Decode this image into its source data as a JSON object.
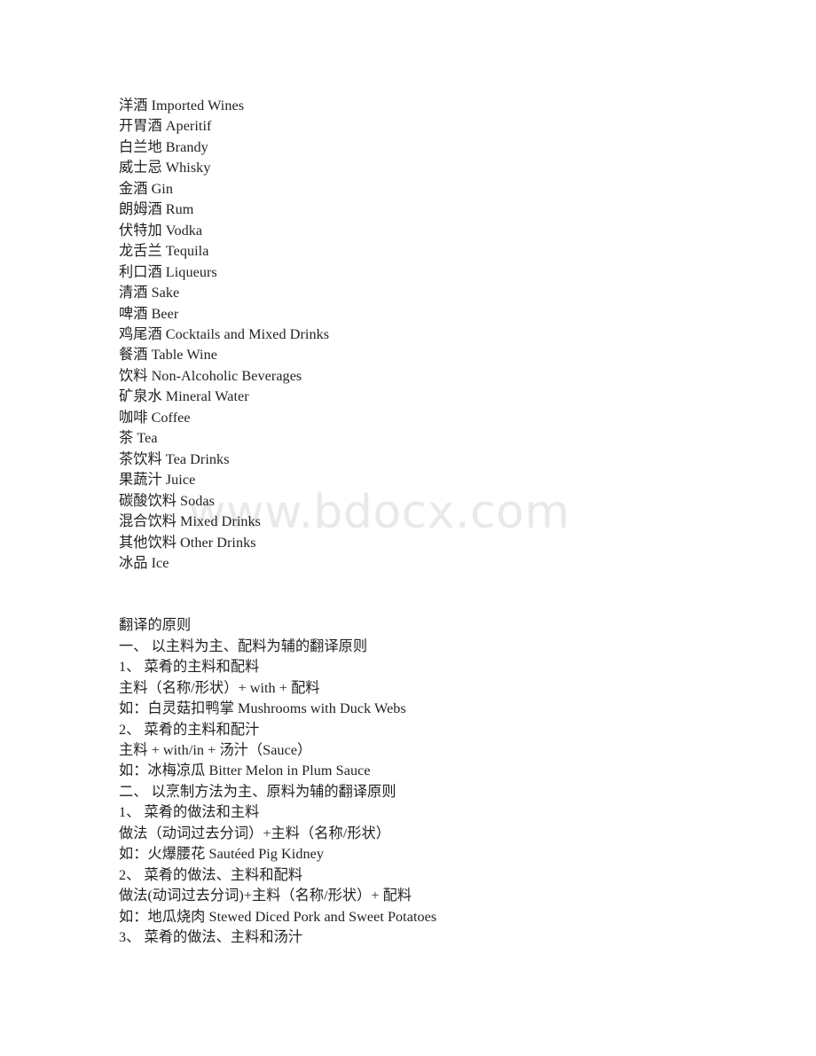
{
  "document": {
    "page_background": "#ffffff",
    "text_color": "#231f20",
    "watermark": {
      "text": "www.bdocx.com",
      "color": "#e9e9e9"
    },
    "sections": [
      {
        "id": "beverage-glossary",
        "name": "beverage-glossary",
        "lines": [
          "洋酒 Imported Wines",
          "开胃酒 Aperitif",
          "白兰地 Brandy",
          "威士忌 Whisky",
          "金酒 Gin",
          "朗姆酒 Rum",
          "伏特加 Vodka",
          "龙舌兰 Tequila",
          "利口酒 Liqueurs",
          "清酒 Sake",
          "啤酒 Beer",
          "鸡尾酒 Cocktails and Mixed Drinks",
          "餐酒 Table Wine",
          "饮料 Non-Alcoholic Beverages",
          "矿泉水 Mineral Water",
          "咖啡 Coffee",
          "茶 Tea",
          "茶饮料 Tea Drinks",
          "果蔬汁 Juice",
          "碳酸饮料 Sodas",
          "混合饮料 Mixed Drinks",
          "其他饮料 Other Drinks",
          "冰品 Ice"
        ]
      },
      {
        "id": "translation-principles",
        "name": "translation-principles",
        "lines": [
          "翻译的原则",
          "一、 以主料为主、配料为辅的翻译原则",
          "1、 菜肴的主料和配料",
          "主料（名称/形状）+ with + 配料",
          "如：白灵菇扣鸭掌 Mushrooms with Duck Webs",
          "2、 菜肴的主料和配汁",
          "主料 + with/in + 汤汁（Sauce）",
          "如：冰梅凉瓜 Bitter Melon in Plum Sauce",
          "二、 以烹制方法为主、原料为辅的翻译原则",
          "1、 菜肴的做法和主料",
          "做法（动词过去分词）+主料（名称/形状）",
          "如：火爆腰花 Sautéed Pig Kidney",
          "2、 菜肴的做法、主料和配料",
          "做法(动词过去分词)+主料（名称/形状）+ 配料",
          "如：地瓜烧肉 Stewed Diced Pork and Sweet Potatoes",
          "3、 菜肴的做法、主料和汤汁"
        ]
      }
    ]
  }
}
